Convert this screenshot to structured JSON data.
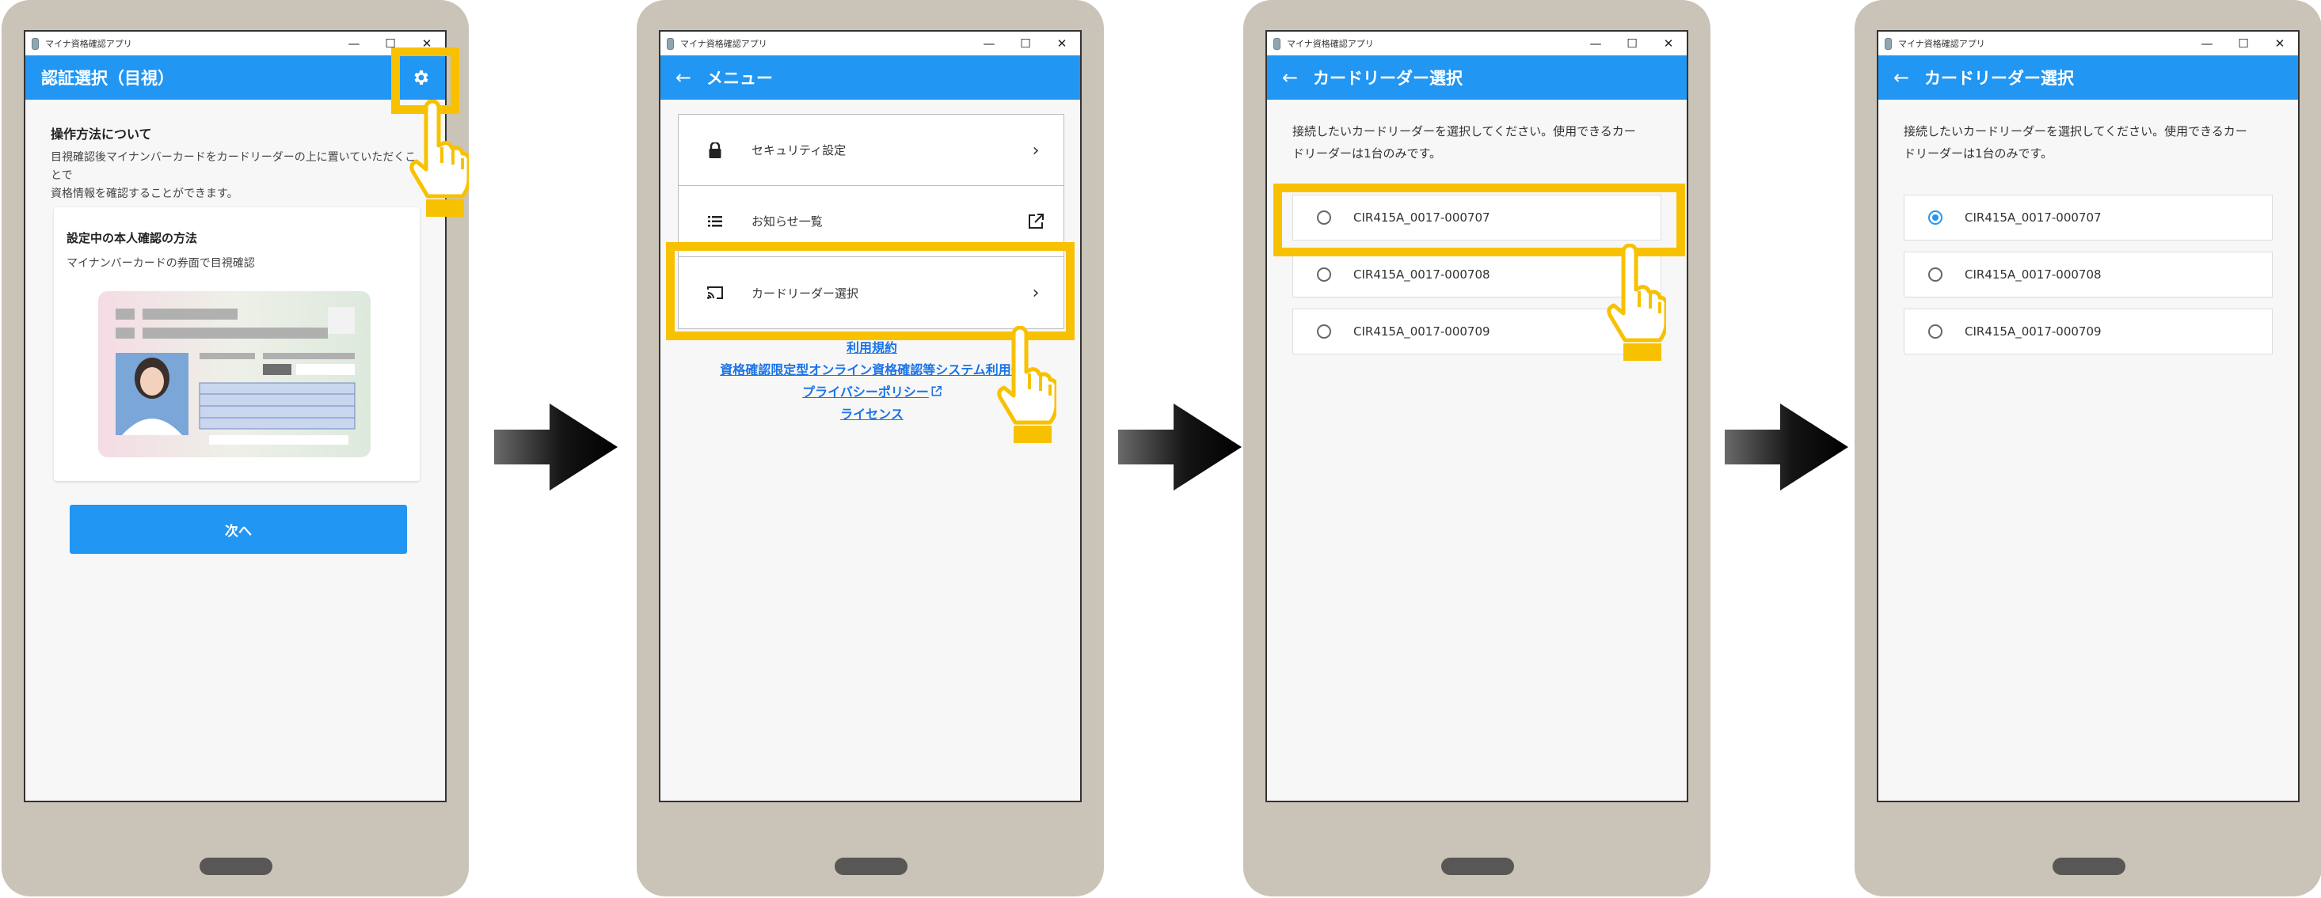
{
  "app": {
    "window_title": "マイナ資格確認アプリ",
    "controls": {
      "minimize": "—",
      "maximize": "☐",
      "close": "✕"
    }
  },
  "screen1": {
    "title": "認証選択（目視）",
    "heading": "操作方法について",
    "description": "目視確認後マイナンバーカードをカードリーダーの上に置いていただくことで\n資格情報を確認することができます。",
    "card_title": "設定中の本人確認の方法",
    "card_subtitle": "マイナンバーカードの券面で目視確認",
    "next_button": "次へ"
  },
  "screen2": {
    "title": "メニュー",
    "menu": [
      {
        "label": "セキュリティ設定",
        "icon": "lock-icon",
        "end": "chevron-right-icon"
      },
      {
        "label": "お知らせ一覧",
        "icon": "list-icon",
        "end": "external-link-icon"
      },
      {
        "label": "カードリーダー選択",
        "icon": "cast-icon",
        "end": "chevron-right-icon"
      }
    ],
    "links": [
      "利用規約",
      "資格確認限定型オンライン資格確認等システム利用規",
      "プライバシーポリシー",
      "ライセンス"
    ]
  },
  "screen3": {
    "title": "カードリーダー選択",
    "description": "接続したいカードリーダーを選択してください。使用できるカー\nドリーダーは1台のみです。",
    "readers": [
      {
        "name": "CIR415A_0017-000707",
        "selected": false
      },
      {
        "name": "CIR415A_0017-000708",
        "selected": false
      },
      {
        "name": "CIR415A_0017-000709",
        "selected": false
      }
    ]
  },
  "screen4": {
    "title": "カードリーダー選択",
    "description": "接続したいカードリーダーを選択してください。使用できるカー\nドリーダーは1台のみです。",
    "readers": [
      {
        "name": "CIR415A_0017-000707",
        "selected": true
      },
      {
        "name": "CIR415A_0017-000708",
        "selected": false
      },
      {
        "name": "CIR415A_0017-000709",
        "selected": false
      }
    ]
  },
  "colors": {
    "appbar": "#2196f3",
    "highlight": "#f8c100",
    "phone_body": "#cac3b7",
    "link": "#1a73e8"
  }
}
